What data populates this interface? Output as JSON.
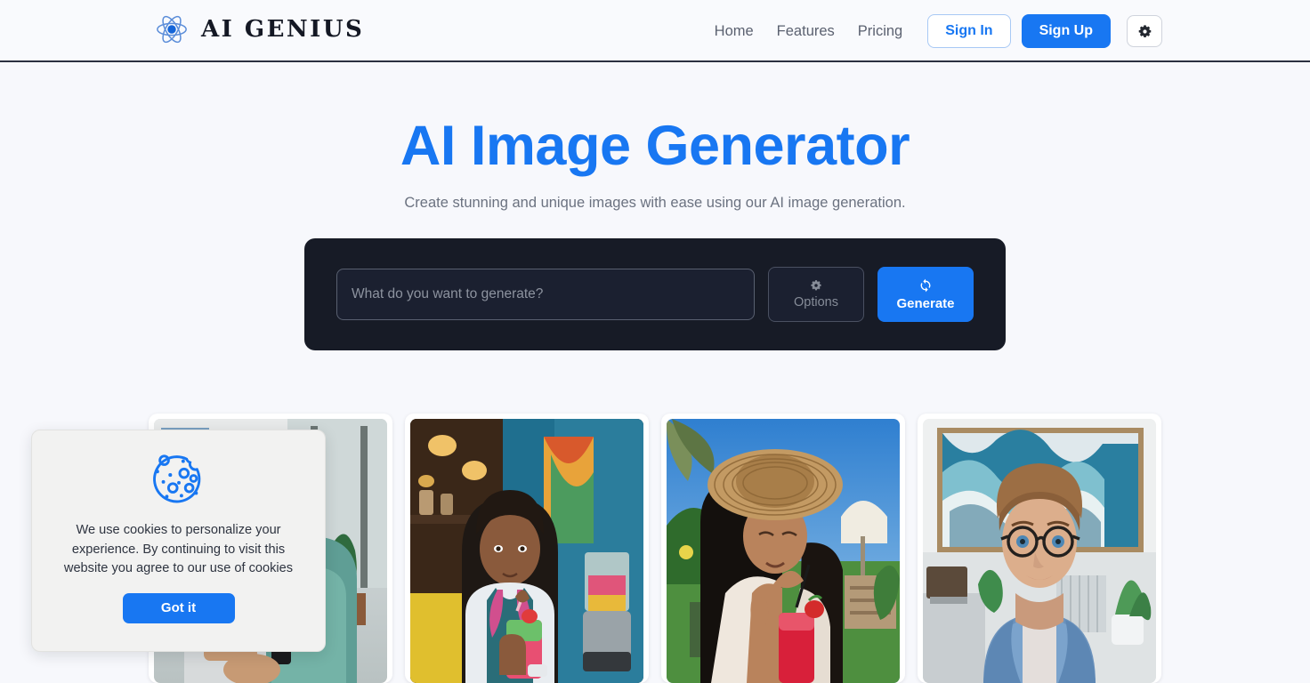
{
  "header": {
    "brand": {
      "name": "AI GENIUS",
      "icon": "atom-icon"
    },
    "nav_links": [
      {
        "label": "Home"
      },
      {
        "label": "Features"
      },
      {
        "label": "Pricing"
      }
    ],
    "sign_in_label": "Sign In",
    "sign_up_label": "Sign Up",
    "settings_icon": "gear-icon"
  },
  "hero": {
    "title": "AI Image Generator",
    "subtitle": "Create stunning and unique images with ease using our AI image generation."
  },
  "generator": {
    "prompt_placeholder": "What do you want to generate?",
    "prompt_value": "",
    "options_label": "Options",
    "options_icon": "gear-icon",
    "generate_label": "Generate",
    "generate_icon": "refresh-icon"
  },
  "gallery": {
    "cards": [
      {
        "alt": "Person seated in teal armchair beside houseplants in a sunlit room"
      },
      {
        "alt": "Smiling woman in lab coat with stethoscope holding a fruit smoothie beside a blender in a colorful cafe"
      },
      {
        "alt": "Woman in a wide straw sun hat sipping a strawberry drink through a straw in a tropical garden"
      },
      {
        "alt": "Woman with round glasses in a denim jacket smiling in a modern office with an abstract blue painting"
      }
    ]
  },
  "cookie_dialog": {
    "icon": "cookie-icon",
    "message": "We use cookies to personalize your experience. By continuing to visit this website you agree to our use of cookies",
    "accept_label": "Got it"
  },
  "colors": {
    "accent_blue": "#1877f2",
    "page_background": "#f7f8fc",
    "panel_dark": "#171b26",
    "text_dark": "#141824",
    "text_muted": "#6b7280",
    "cookie_background": "#f2f2f1"
  }
}
